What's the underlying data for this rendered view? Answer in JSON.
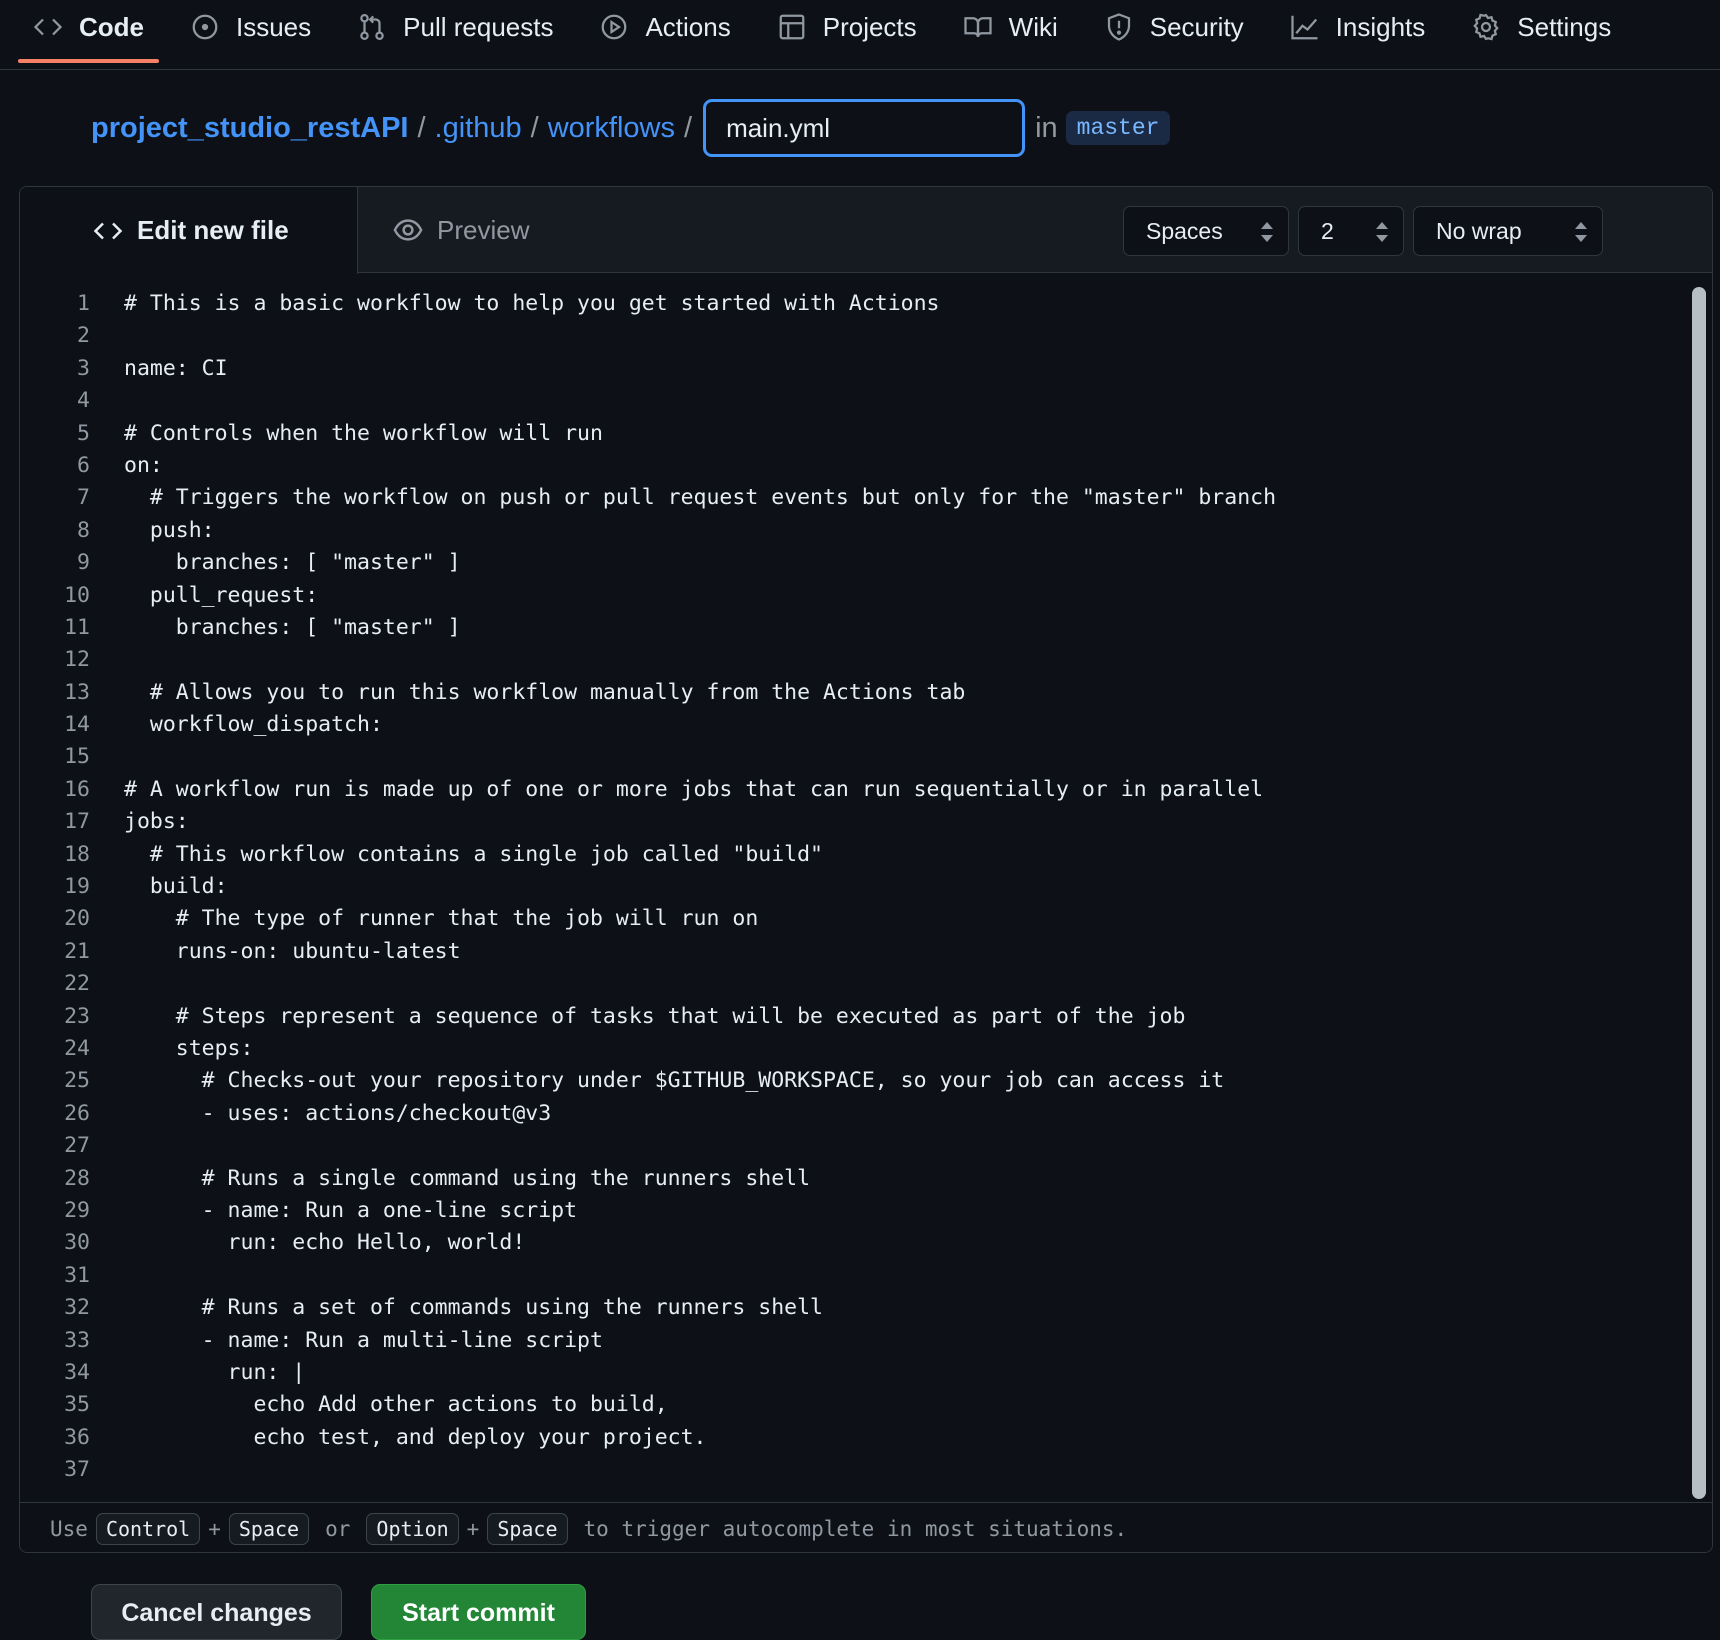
{
  "nav": {
    "tabs": [
      {
        "label": "Code",
        "icon": "code-icon",
        "selected": true
      },
      {
        "label": "Issues",
        "icon": "issue-icon",
        "selected": false
      },
      {
        "label": "Pull requests",
        "icon": "pull-request-icon",
        "selected": false
      },
      {
        "label": "Actions",
        "icon": "play-icon",
        "selected": false
      },
      {
        "label": "Projects",
        "icon": "table-icon",
        "selected": false
      },
      {
        "label": "Wiki",
        "icon": "book-icon",
        "selected": false
      },
      {
        "label": "Security",
        "icon": "shield-icon",
        "selected": false
      },
      {
        "label": "Insights",
        "icon": "graph-icon",
        "selected": false
      },
      {
        "label": "Settings",
        "icon": "gear-icon",
        "selected": false
      }
    ]
  },
  "breadcrumb": {
    "repo": "project_studio_restAPI",
    "folder1": ".github",
    "folder2": "workflows",
    "separator": "/",
    "filename_value": "main.yml",
    "in_label": "in",
    "branch": "master"
  },
  "editor": {
    "edit_tab": "Edit new file",
    "preview_tab": "Preview",
    "indent_mode": "Spaces",
    "indent_size": "2",
    "wrap_mode": "No wrap",
    "lines": [
      "# This is a basic workflow to help you get started with Actions",
      "",
      "name: CI",
      "",
      "# Controls when the workflow will run",
      "on:",
      "  # Triggers the workflow on push or pull request events but only for the \"master\" branch",
      "  push:",
      "    branches: [ \"master\" ]",
      "  pull_request:",
      "    branches: [ \"master\" ]",
      "",
      "  # Allows you to run this workflow manually from the Actions tab",
      "  workflow_dispatch:",
      "",
      "# A workflow run is made up of one or more jobs that can run sequentially or in parallel",
      "jobs:",
      "  # This workflow contains a single job called \"build\"",
      "  build:",
      "    # The type of runner that the job will run on",
      "    runs-on: ubuntu-latest",
      "",
      "    # Steps represent a sequence of tasks that will be executed as part of the job",
      "    steps:",
      "      # Checks-out your repository under $GITHUB_WORKSPACE, so your job can access it",
      "      - uses: actions/checkout@v3",
      "",
      "      # Runs a single command using the runners shell",
      "      - name: Run a one-line script",
      "        run: echo Hello, world!",
      "",
      "      # Runs a set of commands using the runners shell",
      "      - name: Run a multi-line script",
      "        run: |",
      "          echo Add other actions to build,",
      "          echo test, and deploy your project.",
      ""
    ]
  },
  "hint": {
    "use": "Use",
    "key1": "Control",
    "plus": "+",
    "key2": "Space",
    "or": "or",
    "key3": "Option",
    "key4": "Space",
    "tail": "to trigger autocomplete in most situations."
  },
  "actions": {
    "cancel_label": "Cancel changes",
    "commit_label": "Start commit"
  },
  "colors": {
    "accent_link": "#4493f8",
    "selected_tab_underline": "#f78166",
    "commit_green": "#238636",
    "background": "#0d1117"
  }
}
